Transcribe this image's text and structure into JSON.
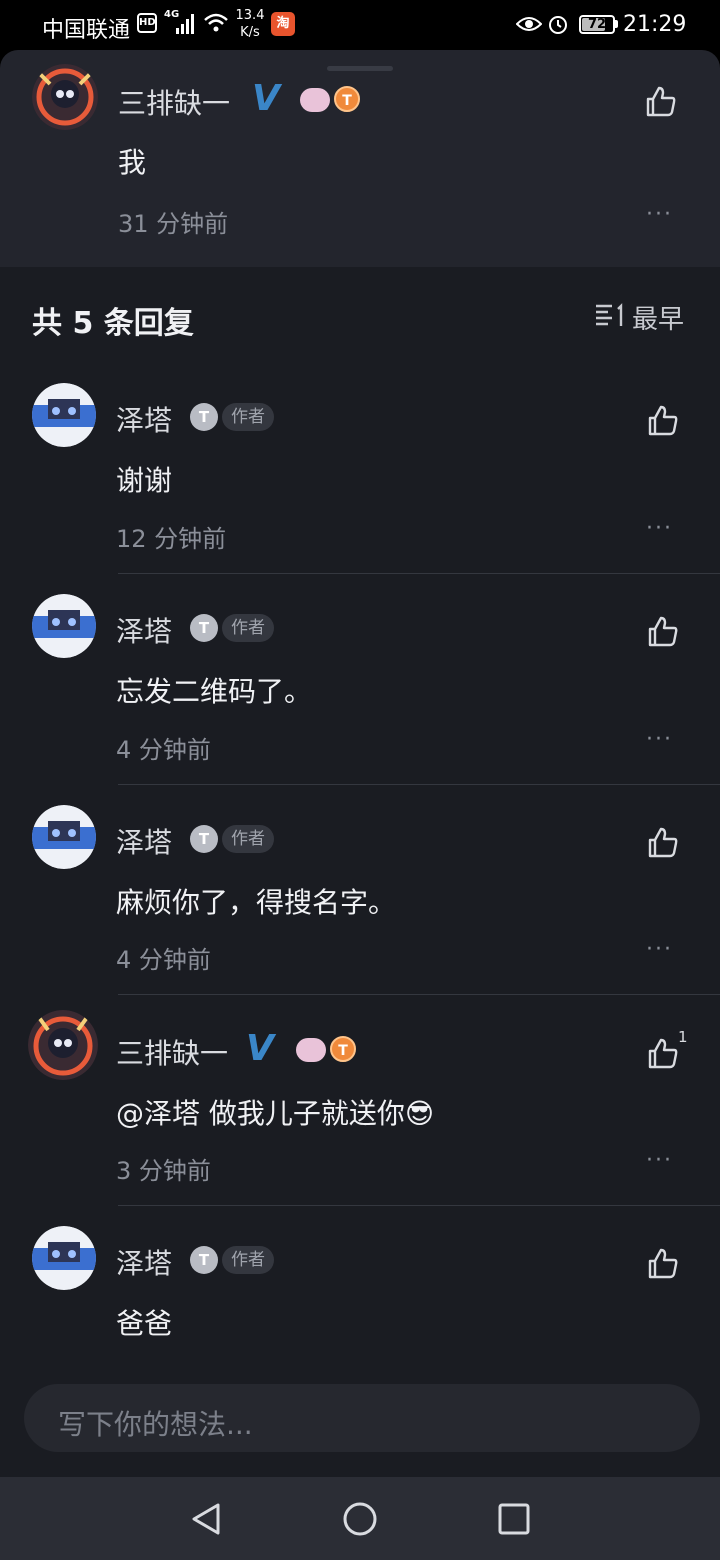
{
  "status_bar": {
    "carrier": "中国联通",
    "hd": "HD",
    "network": "4G",
    "speed_value": "13.4",
    "speed_unit": "K/s",
    "battery": "72",
    "time": "21:29"
  },
  "main_comment": {
    "username": "三排缺一",
    "content": "我",
    "time": "31 分钟前",
    "more": "···"
  },
  "replies_header": {
    "title": "共 5 条回复",
    "sort_label": "最早"
  },
  "replies": [
    {
      "username": "泽塔",
      "level": "T",
      "tag": "作者",
      "content": "谢谢",
      "time": "12 分钟前",
      "more": "···",
      "likes": ""
    },
    {
      "username": "泽塔",
      "level": "T",
      "tag": "作者",
      "content": "忘发二维码了。",
      "time": "4 分钟前",
      "more": "···",
      "likes": ""
    },
    {
      "username": "泽塔",
      "level": "T",
      "tag": "作者",
      "content": "麻烦你了，得搜名字。",
      "time": "4 分钟前",
      "more": "···",
      "likes": ""
    },
    {
      "username": "三排缺一",
      "level": "T",
      "tag": "",
      "content": "@泽塔  做我儿子就送你😎",
      "time": "3 分钟前",
      "more": "···",
      "likes": "1"
    },
    {
      "username": "泽塔",
      "level": "T",
      "tag": "作者",
      "content": "爸爸",
      "time": "",
      "more": "",
      "likes": ""
    }
  ],
  "composer": {
    "placeholder": "写下你的想法..."
  },
  "colors": {
    "background": "#1a1c22",
    "sheet": "#23252d",
    "vip_blue": "#3a86c8",
    "level_orange": "#f08a3b"
  }
}
